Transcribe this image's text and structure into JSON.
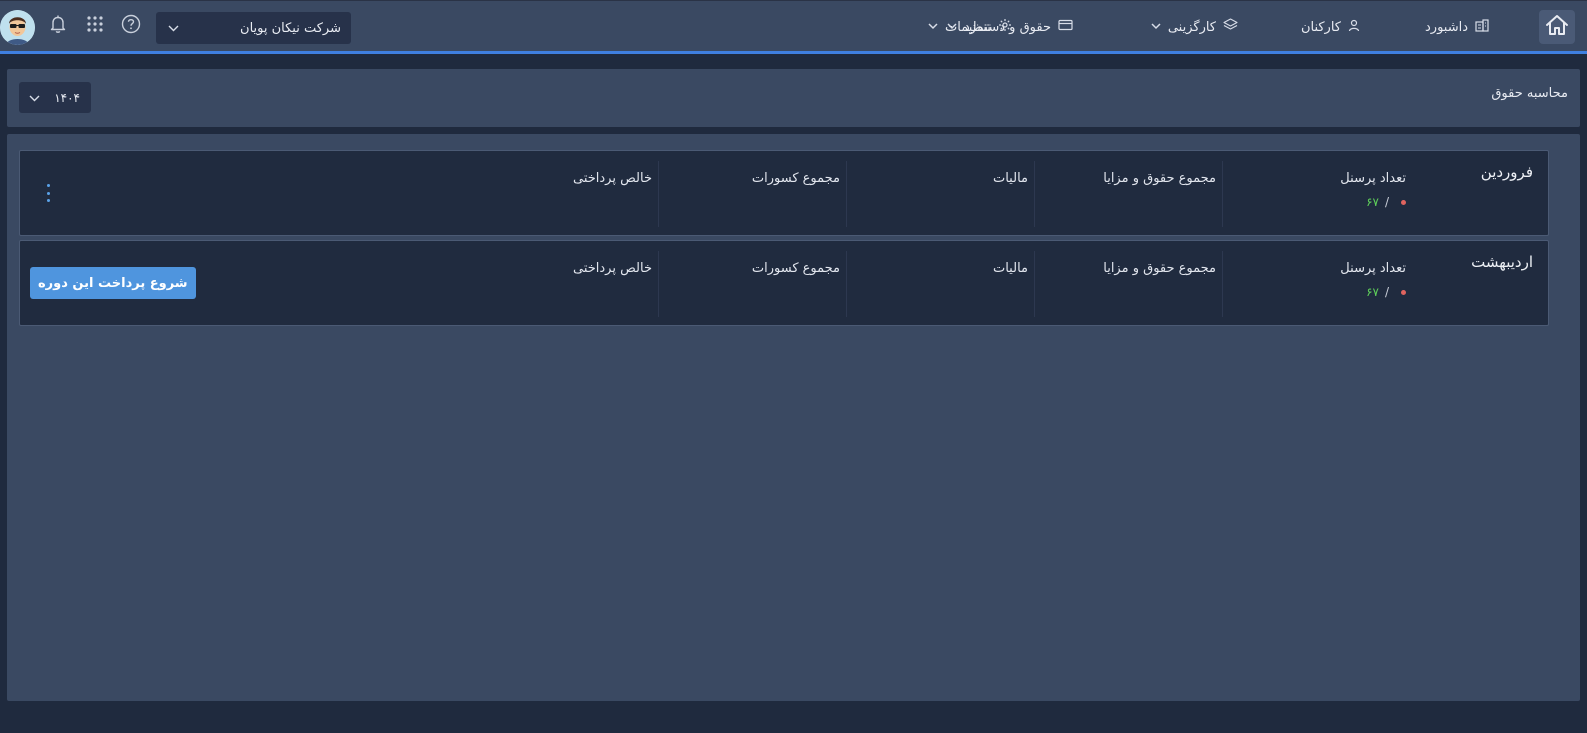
{
  "navbar": {
    "items": [
      {
        "label": "داشبورد",
        "icon": "building-icon",
        "has_dropdown": false
      },
      {
        "label": "کارکنان",
        "icon": "user-icon",
        "has_dropdown": false
      },
      {
        "label": "کارگزینی",
        "icon": "layers-icon",
        "has_dropdown": true
      },
      {
        "label": "حقوق و دستمزد",
        "icon": "card-icon",
        "has_dropdown": true
      },
      {
        "label": "تنظیمات",
        "icon": "gear-icon",
        "has_dropdown": true
      }
    ],
    "company": {
      "selected": "شرکت نیکان پویان"
    },
    "icons": [
      "home-icon",
      "help-icon",
      "apps-grid-icon",
      "bell-icon",
      "avatar"
    ],
    "accent_color": "#3f7fe0"
  },
  "header": {
    "title": "محاسبه حقوق",
    "year_select": {
      "selected": "۱۴۰۴"
    }
  },
  "columns": {
    "personnel_count": "تعداد پرسنل",
    "total_salary_benefits": "مجموع حقوق و مزایا",
    "tax": "مالیات",
    "total_deductions": "مجموع کسورات",
    "net_payment": "خالص پرداختی"
  },
  "periods": [
    {
      "name": "فروردین",
      "personnel_processed": "",
      "personnel_total": "۶۷",
      "action": "more-menu"
    },
    {
      "name": "اردیبهشت",
      "personnel_processed": "",
      "personnel_total": "۶۷",
      "action_label": "شروع پرداخت این دوره"
    }
  ],
  "colors": {
    "processed_dot": "#e0645f",
    "total_count": "#5fcf5a",
    "primary_button": "#4f95de"
  }
}
